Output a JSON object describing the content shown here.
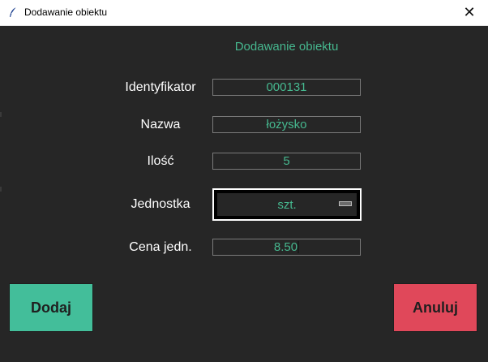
{
  "window": {
    "title": "Dodawanie obiektu",
    "close_symbol": "✕",
    "icon": "feather-icon"
  },
  "form": {
    "heading": "Dodawanie obiektu",
    "fields": {
      "identifier": {
        "label": "Identyfikator",
        "value": "000131"
      },
      "name": {
        "label": "Nazwa",
        "value": "łożysko"
      },
      "quantity": {
        "label": "Ilość",
        "value": "5"
      },
      "unit": {
        "label": "Jednostka",
        "value": "szt."
      },
      "price": {
        "label": "Cena jedn.",
        "value": "8.50"
      }
    }
  },
  "buttons": {
    "add": "Dodaj",
    "cancel": "Anuluj"
  },
  "colors": {
    "background": "#262626",
    "accent": "#46b88f",
    "add_button": "#43be9a",
    "cancel_button": "#e0485a"
  }
}
